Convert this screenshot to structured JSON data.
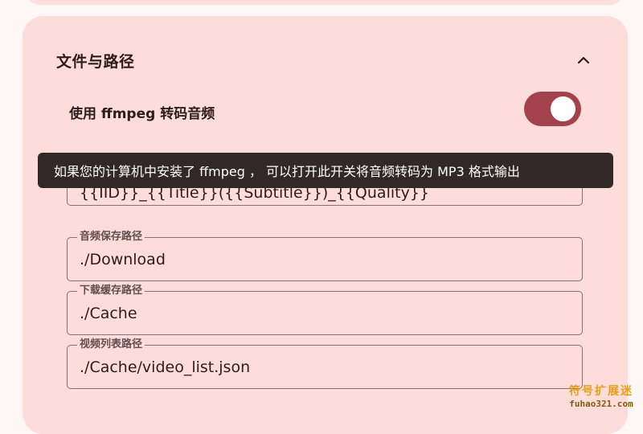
{
  "section": {
    "title": "文件与路径",
    "collapse_icon": "chevron-up-icon"
  },
  "ffmpeg_toggle": {
    "label": "使用 ffmpeg 转码音频",
    "state": "on",
    "accent_color": "#a3424c"
  },
  "tooltip": {
    "text": "如果您的计算机中安装了 ffmpeg ， 可以打开此开关将音频转码为 MP3 格式输出"
  },
  "fields": [
    {
      "label": "",
      "value": "{{IID}}_{{Title}}({{Subtitle}})_{{Quality}}"
    },
    {
      "label": "音频保存路径",
      "value": "./Download"
    },
    {
      "label": "下载缓存路径",
      "value": "./Cache"
    },
    {
      "label": "视频列表路径",
      "value": "./Cache/video_list.json"
    }
  ],
  "watermark": {
    "title": "符号扩展迷",
    "url": "fuhao321.com"
  }
}
